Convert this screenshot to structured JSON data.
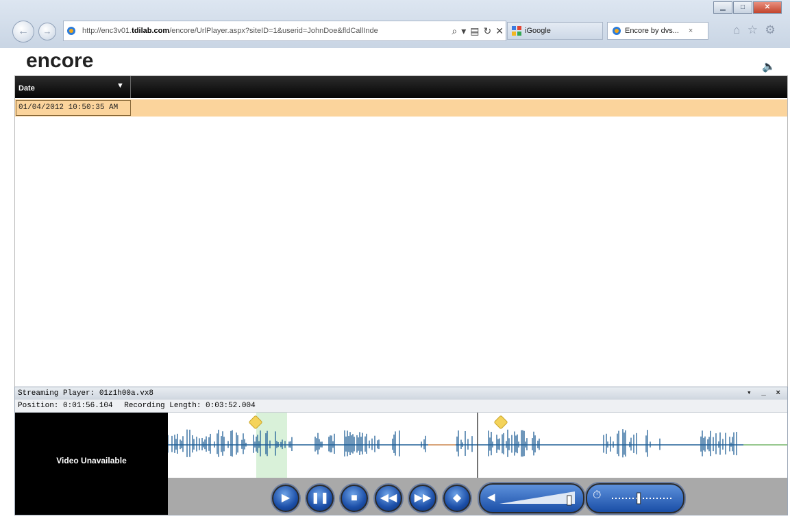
{
  "browser": {
    "url_prefix": "http://enc3v01.",
    "url_domain": "tdilab.com",
    "url_path": "/encore/UrlPlayer.aspx?siteID=1&userid=JohnDoe&fldCallInde",
    "tabs": [
      {
        "label": "iGoogle"
      },
      {
        "label": "Encore by dvs..."
      }
    ],
    "tab_close": "×"
  },
  "app": {
    "logo": "encore"
  },
  "grid": {
    "column_date": "Date",
    "rows": [
      {
        "date": "01/04/2012 10:50:35 AM"
      }
    ]
  },
  "player": {
    "title": "Streaming Player: 01z1h00a.vx8",
    "controls_text": "▾ _ ×",
    "position_label": "Position: 0:01:56.104",
    "length_label": "Recording Length: 0:03:52.004",
    "video_message": "Video Unavailable",
    "progress": {
      "position_fraction": 0.5,
      "volume_fraction": 0.95,
      "speed_fraction": 0.45
    },
    "buttons": [
      "play",
      "pause",
      "stop",
      "rewind",
      "fast-forward",
      "tag"
    ]
  },
  "colors": {
    "selected_row": "#fbd49c",
    "grid_header": "#0c0c0c",
    "waveform": "#1f5f96",
    "player_button": "#1c4fa8",
    "bookmark": "#f4d35a"
  }
}
